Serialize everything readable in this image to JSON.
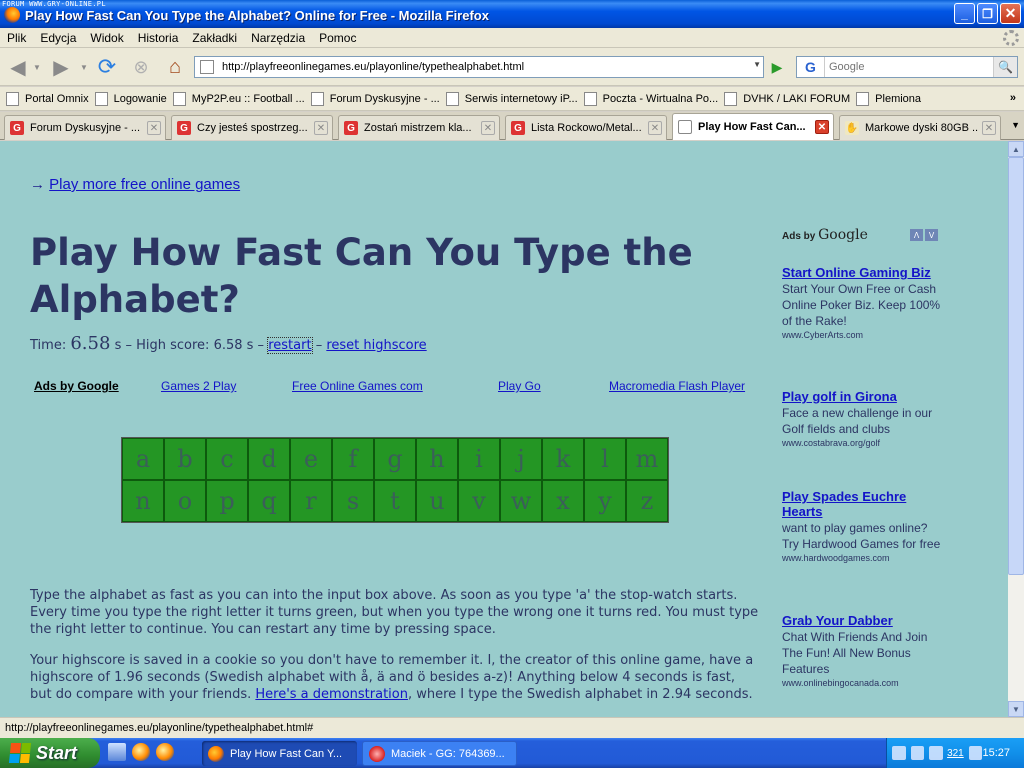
{
  "window": {
    "watermark": "FORUM WWW.GRY-ONLINE.PL",
    "title": "Play How Fast Can You Type the Alphabet? Online for Free - Mozilla Firefox",
    "minimize": "_",
    "maximize": "❐",
    "close": "✕"
  },
  "menu": [
    "Plik",
    "Edycja",
    "Widok",
    "Historia",
    "Zakładki",
    "Narzędzia",
    "Pomoc"
  ],
  "nav": {
    "url": "http://playfreeonlinegames.eu/playonline/typethealphabet.html",
    "search_engine": "G",
    "search_placeholder": "Google"
  },
  "bookmarks": [
    {
      "label": "Portal Omnix",
      "icon": "omnix-icon"
    },
    {
      "label": "Logowanie",
      "icon": "key-icon"
    },
    {
      "label": "MyP2P.eu :: Football ...",
      "icon": "page-icon"
    },
    {
      "label": "Forum Dyskusyjne - ...",
      "icon": "page-icon"
    },
    {
      "label": "Serwis internetowy iP...",
      "icon": "bank-icon"
    },
    {
      "label": "Poczta - Wirtualna Po...",
      "icon": "page-icon"
    },
    {
      "label": "DVHK / LAKI FORUM",
      "icon": "folder-icon"
    },
    {
      "label": "Plemiona",
      "icon": "shield-icon"
    }
  ],
  "bookmarks_more": "»",
  "tabs": [
    {
      "label": "Forum Dyskusyjne - ...",
      "icon": "G",
      "active": false
    },
    {
      "label": "Czy jesteś spostrzeg...",
      "icon": "G",
      "active": false
    },
    {
      "label": "Zostań mistrzem kla...",
      "icon": "G",
      "active": false
    },
    {
      "label": "Lista Rockowo/Metal...",
      "icon": "G",
      "active": false
    },
    {
      "label": "Play How Fast Can...",
      "icon": "",
      "active": true
    },
    {
      "label": "Markowe dyski 80GB ...",
      "icon": "",
      "active": false
    }
  ],
  "page": {
    "arrow": "→",
    "more_games": "Play more free online games",
    "heading": "Play How Fast Can You Type the Alphabet?",
    "time_label": "Time:",
    "time_value": "6.58",
    "time_unit": "s",
    "high_score": "– High score: 6.58 s –",
    "restart": "restart",
    "dash": "–",
    "reset": "reset highscore",
    "ads_label": "Ads by Google",
    "ads_links": [
      "Games 2 Play",
      "Free Online Games com",
      "Play Go",
      "Macromedia Flash Player"
    ],
    "letters": [
      "a",
      "b",
      "c",
      "d",
      "e",
      "f",
      "g",
      "h",
      "i",
      "j",
      "k",
      "l",
      "m",
      "n",
      "o",
      "p",
      "q",
      "r",
      "s",
      "t",
      "u",
      "v",
      "w",
      "x",
      "y",
      "z"
    ],
    "letter_cell_color": "#249624",
    "para1": "Type the alphabet as fast as you can into the input box above. As soon as you type 'a' the stop-watch starts. Every time you type the right letter it turns green, but when you type the wrong one it turns red. You must type the right letter to continue. You can restart any time by pressing space.",
    "para2_pre": "Your highscore is saved in a cookie so you don't have to remember it. I, the creator of this online game, have a highscore of 1.96 seconds (Swedish alphabet with å, ä and ö besides a-z)! Anything below 4 seconds is fast, but do compare with your friends. ",
    "para2_link": "Here's a demonstration",
    "para2_post": ", where I type the Swedish alphabet in 2.94 seconds."
  },
  "side_ads": {
    "ads_by": "Ads by",
    "google": "Google",
    "nav_prev": "Λ",
    "nav_next": "V",
    "items": [
      {
        "title": "Start Online Gaming Biz",
        "desc": "Start Your Own Free or Cash Online Poker Biz. Keep 100% of the Rake!",
        "url": "www.CyberArts.com"
      },
      {
        "title": "Play golf in Girona",
        "desc": "Face a new challenge in our Golf fields and clubs",
        "url": "www.costabrava.org/golf"
      },
      {
        "title": "Play Spades Euchre Hearts",
        "desc": "want to play games online? Try Hardwood Games for free",
        "url": "www.hardwoodgames.com"
      },
      {
        "title": "Grab Your Dabber",
        "desc": "Chat With Friends And Join The Fun! All New Bonus Features",
        "url": "www.onlinebingocanada.com"
      }
    ]
  },
  "status_text": "http://playfreeonlinegames.eu/playonline/typethealphabet.html#",
  "taskbar": {
    "start": "Start",
    "tasks": [
      "Play How Fast Can Y...",
      "Maciek - GG: 764369..."
    ],
    "tray_number": "321",
    "clock": "15:27"
  },
  "colors": {
    "page_background": "#99cccc",
    "heading": "#2c3563",
    "link": "#1414c8"
  }
}
